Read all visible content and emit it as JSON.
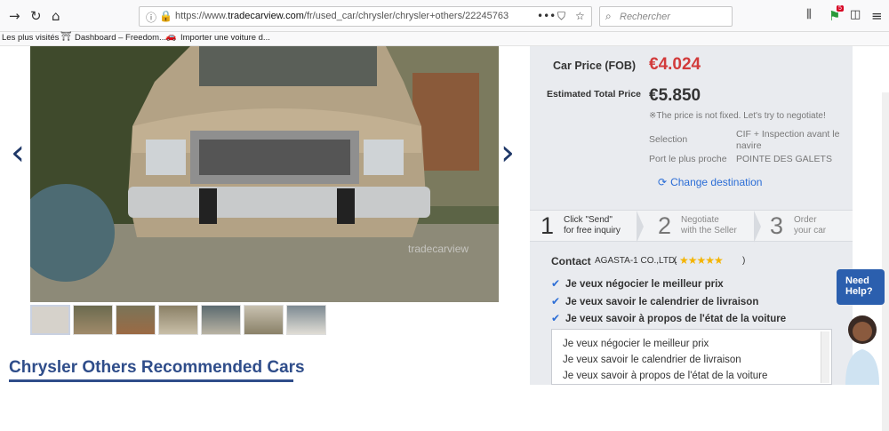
{
  "browser": {
    "url_prefix": "https://www.",
    "url_host": "tradecarview.com",
    "url_path": "/fr/used_car/chrysler/chrysler+others/22245763/?sp",
    "search_placeholder": "Rechercher",
    "notification_count": "5"
  },
  "bookmarks": [
    {
      "label": "Les plus visités"
    },
    {
      "label": "Dashboard – Freedom..."
    },
    {
      "label": "Importer une voiture d..."
    }
  ],
  "gallery": {
    "watermark": "tradecarview",
    "thumb_count": 7
  },
  "recommended": {
    "title": "Chrysler Others Recommended Cars"
  },
  "price": {
    "car_price_label": "Car Price (FOB)",
    "car_price_value": "€4.024",
    "total_label": "Estimated Total Price",
    "total_value": "€5.850",
    "note": "※The price is not fixed. Let's try to negotiate!",
    "selection_label": "Selection",
    "selection_value": "CIF + Inspection avant le navire",
    "port_label": "Port le plus proche",
    "port_value": "POINTE DES GALETS",
    "change_destination": "Change destination"
  },
  "steps": [
    {
      "num": "1",
      "line1": "Click \"Send\"",
      "line2": "for free inquiry"
    },
    {
      "num": "2",
      "line1": "Negotiate",
      "line2": "with the Seller"
    },
    {
      "num": "3",
      "line1": "Order",
      "line2": "your car"
    }
  ],
  "contact": {
    "label": "Contact",
    "company": "AGASTA-1 CO.,LTD.",
    "rating": 5,
    "paren_open": "(",
    "paren_close": ")",
    "options": [
      "Je veux négocier le meilleur prix",
      "Je veux savoir le calendrier de livraison",
      "Je veux savoir à propos de l'état de la voiture"
    ],
    "message_lines": [
      "Je veux négocier le meilleur prix",
      "Je veux savoir le calendrier de livraison",
      "Je veux savoir à propos de l'état de la voiture"
    ]
  },
  "help": {
    "line1": "Need",
    "line2": "Help?"
  }
}
